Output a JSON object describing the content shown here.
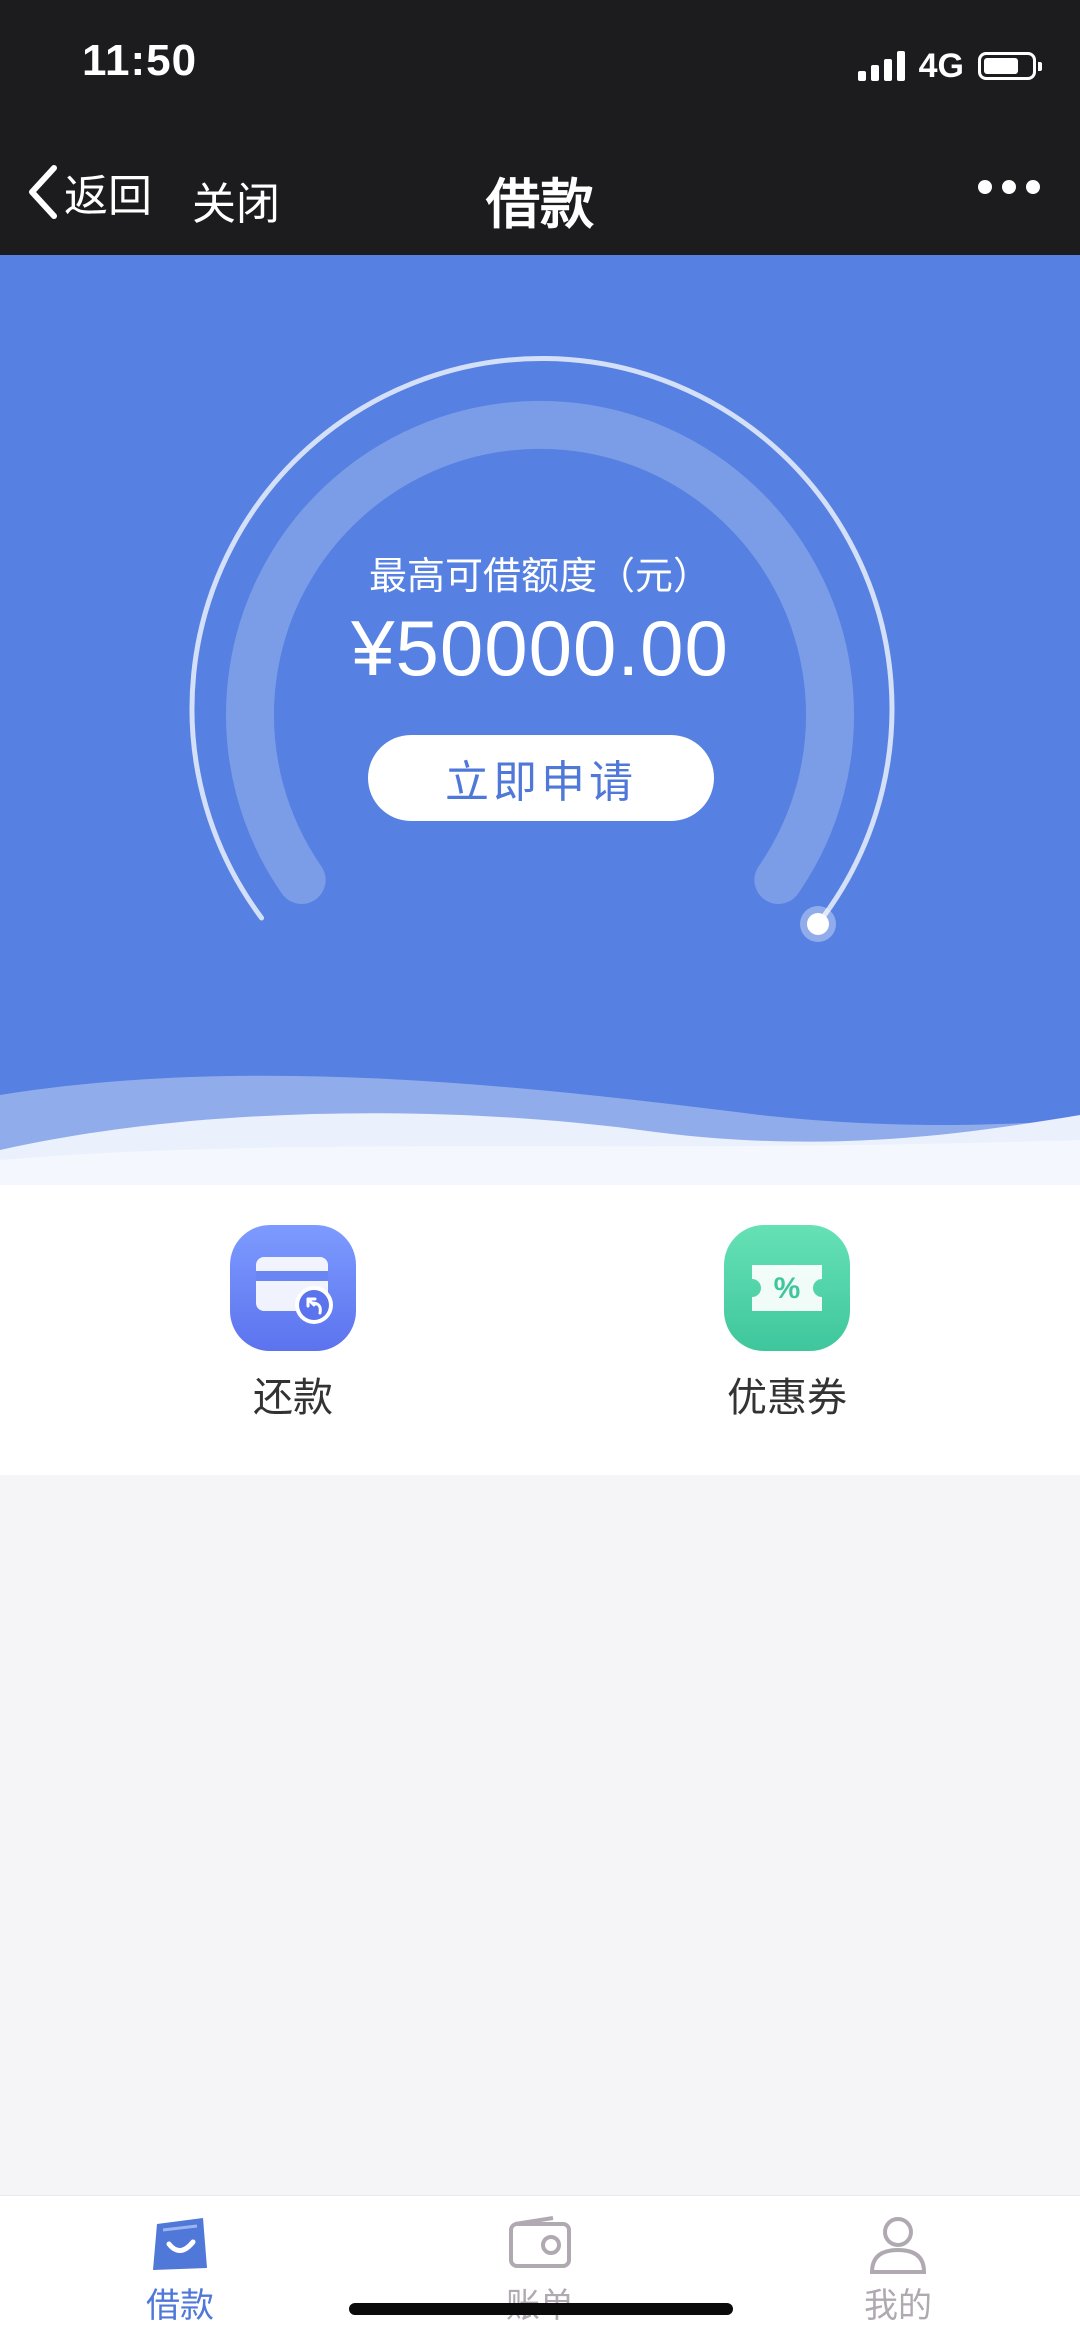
{
  "status_bar": {
    "time": "11:50",
    "network": "4G"
  },
  "nav": {
    "back_label": "返回",
    "close_label": "关闭",
    "title": "借款"
  },
  "hero": {
    "credit_label": "最高可借额度（元）",
    "credit_amount": "¥50000.00",
    "apply_label": "立即申请"
  },
  "actions": [
    {
      "label": "还款",
      "icon": "card-repay-icon"
    },
    {
      "label": "优惠券",
      "icon": "coupon-icon"
    }
  ],
  "tabs": [
    {
      "label": "借款",
      "icon": "bag-icon",
      "active": true
    },
    {
      "label": "账单",
      "icon": "wallet-icon",
      "active": false
    },
    {
      "label": "我的",
      "icon": "user-icon",
      "active": false
    }
  ],
  "colors": {
    "hero_bg": "#5680e1",
    "accent": "#4f78d8",
    "repay_icon": "#6a85f4",
    "coupon_icon": "#4ccfa4",
    "bar_bg": "#1c1c1f"
  }
}
